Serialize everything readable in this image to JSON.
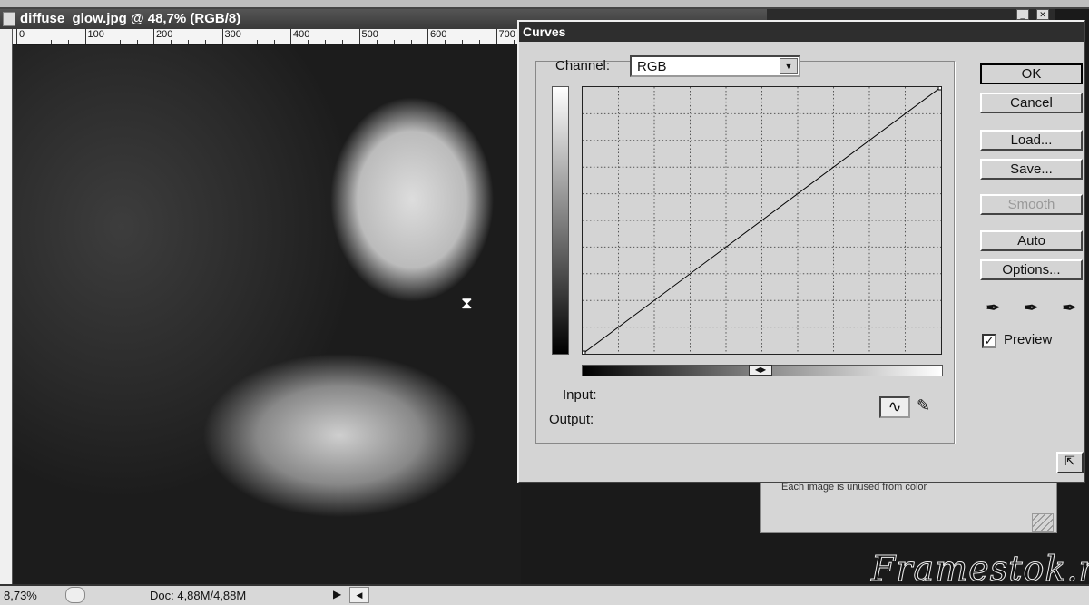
{
  "document": {
    "title": "diffuse_glow.jpg @ 48,7% (RGB/8)",
    "ruler_labels": [
      "0",
      "100",
      "200",
      "300",
      "400",
      "500",
      "600",
      "700"
    ]
  },
  "status": {
    "zoom": "8,73%",
    "doc": "Doc: 4,88M/4,88M"
  },
  "background_panel": {
    "text": "Each image is unused from color"
  },
  "curves": {
    "title": "Curves",
    "channel_label": "Channel:",
    "channel_value": "RGB",
    "input_label": "Input:",
    "output_label": "Output:",
    "buttons": {
      "ok": "OK",
      "cancel": "Cancel",
      "load": "Load...",
      "save": "Save...",
      "smooth": "Smooth",
      "auto": "Auto",
      "options": "Options..."
    },
    "preview_label": "Preview",
    "preview_checked": true,
    "curve_points": [
      [
        0,
        0
      ],
      [
        255,
        255
      ]
    ]
  },
  "watermark": "Framestok.ru"
}
